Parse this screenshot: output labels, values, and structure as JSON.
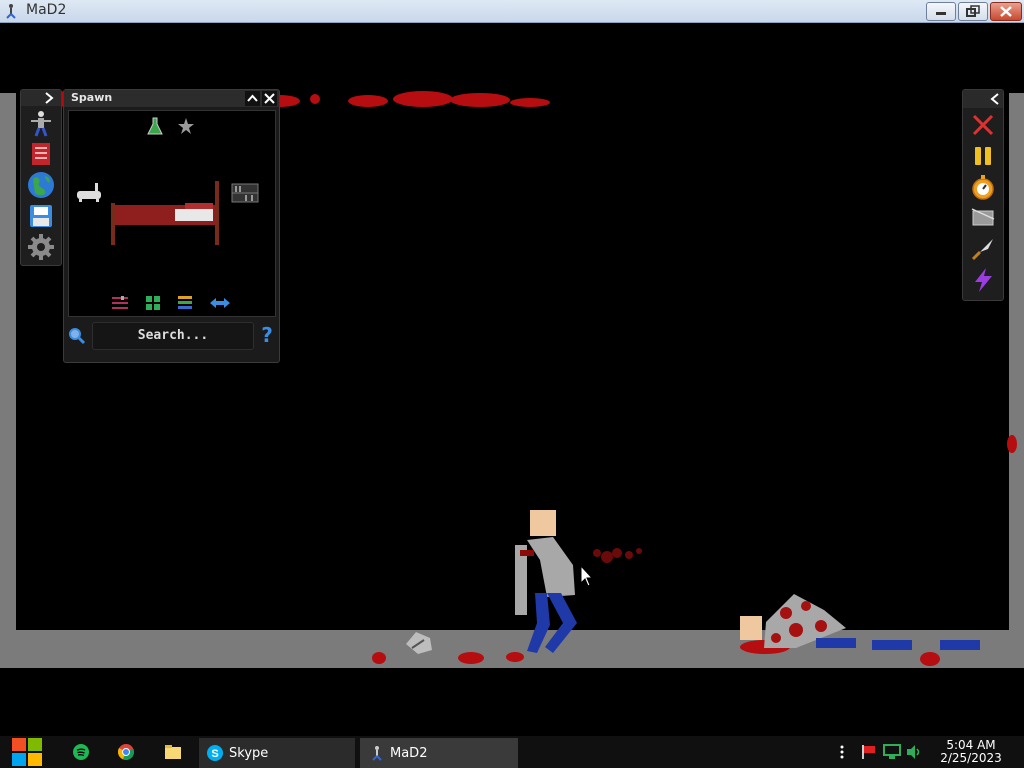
{
  "window": {
    "title": "MaD2"
  },
  "spawn_panel": {
    "title": "Spawn",
    "search_placeholder": "Search...",
    "help": "?"
  },
  "left_toolbar": {
    "items": [
      "character-icon",
      "book-icon",
      "globe-icon",
      "save-icon",
      "settings-gear-icon"
    ]
  },
  "right_toolbar": {
    "items": [
      "close-x-icon",
      "pause-icon",
      "stopwatch-icon",
      "box-icon",
      "knife-icon",
      "lightning-icon"
    ]
  },
  "taskbar": {
    "apps": [
      {
        "label": "Skype"
      },
      {
        "label": "MaD2"
      }
    ],
    "time": "5:04 AM",
    "date": "2/25/2023"
  },
  "colors": {
    "blood": "#b50d10",
    "arena_border": "#7b7b7b",
    "panel": "#1b1b1b",
    "accent_blue": "#3a8de0"
  }
}
